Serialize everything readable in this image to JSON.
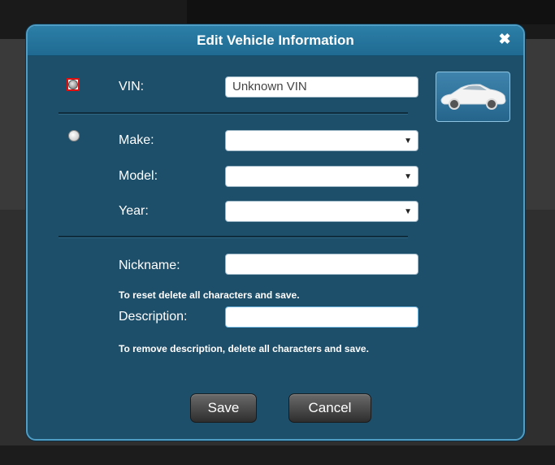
{
  "dialog": {
    "title": "Edit Vehicle Information",
    "close_symbol": "✖"
  },
  "form": {
    "vin_label": "VIN:",
    "vin_value": "Unknown VIN",
    "make_label": "Make:",
    "model_label": "Model:",
    "year_label": "Year:",
    "nickname_label": "Nickname:",
    "nickname_hint": "To reset delete all characters and save.",
    "description_label": "Description:",
    "description_hint": "To remove description, delete all characters and save.",
    "select_arrow": "▼"
  },
  "buttons": {
    "save": "Save",
    "cancel": "Cancel"
  },
  "radio": {
    "vin_selected": true,
    "make_model_selected": false
  },
  "icons": {
    "close": "close-icon",
    "car": "car-icon"
  },
  "colors": {
    "dialog_bg": "#1e4f6a",
    "titlebar": "#2c7fa8",
    "border": "#4f9cc4"
  }
}
